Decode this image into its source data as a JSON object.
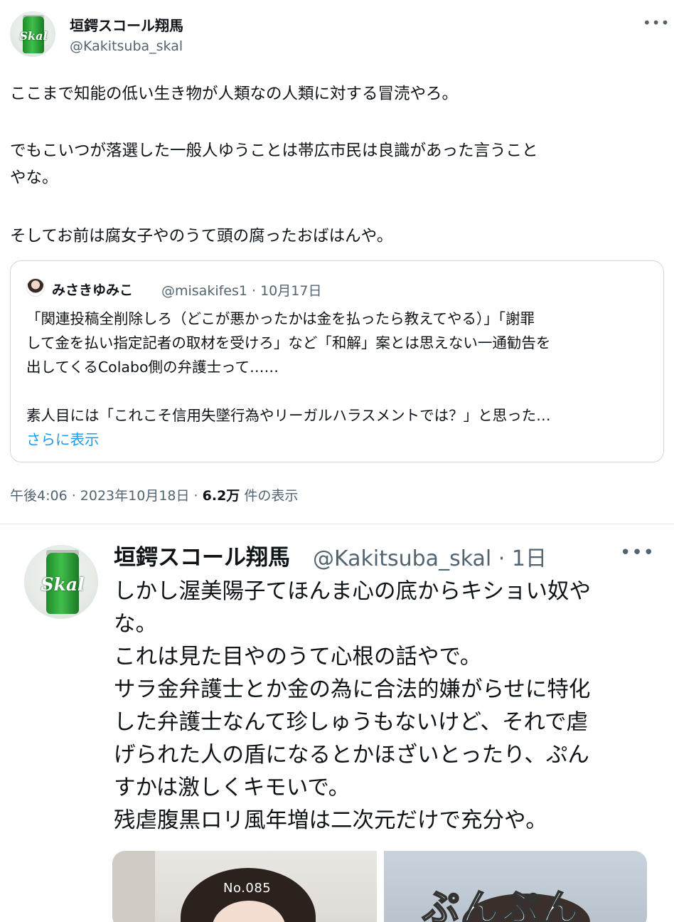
{
  "tweet1": {
    "display_name": "垣鍔スコール翔馬",
    "handle": "@Kakitsuba_skal",
    "avatar_label": "Skal",
    "more_label": "•••",
    "text_lines": [
      "ここまで知能の低い生き物が人類なの人類に対する冒涜やろ。",
      "でもこいつが落選した一般人ゆうことは帯広市民は良識があった言うこと",
      "やな。",
      "そしてお前は腐女子やのうて頭の腐ったおばはんや。"
    ],
    "quote": {
      "display_name": "みさきゆみこ",
      "meta": "@misakifes1 · 10月17日",
      "lines": [
        "「関連投稿全削除しろ（どこが悪かったかは金を払ったら教えてやる）」「謝罪",
        "して金を払い指定記者の取材を受けろ」など「和解」案とは思えない一通勧告を",
        "出してくるColabo側の弁護士って……",
        "素人目には「これこそ信用失墜行為やリーガルハラスメントでは？」と思った…"
      ],
      "show_more": "さらに表示"
    },
    "timestamp": "午後4:06 · 2023年10月18日 · ",
    "views_count": "6.2万",
    "views_label": " 件の表示"
  },
  "tweet2": {
    "display_name": "垣鍔スコール翔馬",
    "meta": "@Kakitsuba_skal · 1日",
    "avatar_label": "Skal",
    "more_label": "•••",
    "text_lines": [
      "しかし渥美陽子てほんま心の底からキショい奴や",
      "な。",
      "これは見た目やのうて心根の話やで。",
      "サラ金弁護士とか金の為に合法的嫌がらせに特化",
      "した弁護士なんて珍しゅうもないけど、それで虐",
      "げられた人の盾になるとかほざいとったり、ぷん",
      "すかは激しくキモいで。",
      "残虐腹黒ロリ風年増は二次元だけで充分や。"
    ],
    "media": {
      "image1_label": "No.085",
      "image2_text": "ぷんぷん"
    }
  },
  "colors": {
    "text": "#0f1419",
    "secondary": "#536471",
    "link": "#1d9bf0",
    "border": "#cfd9de"
  }
}
